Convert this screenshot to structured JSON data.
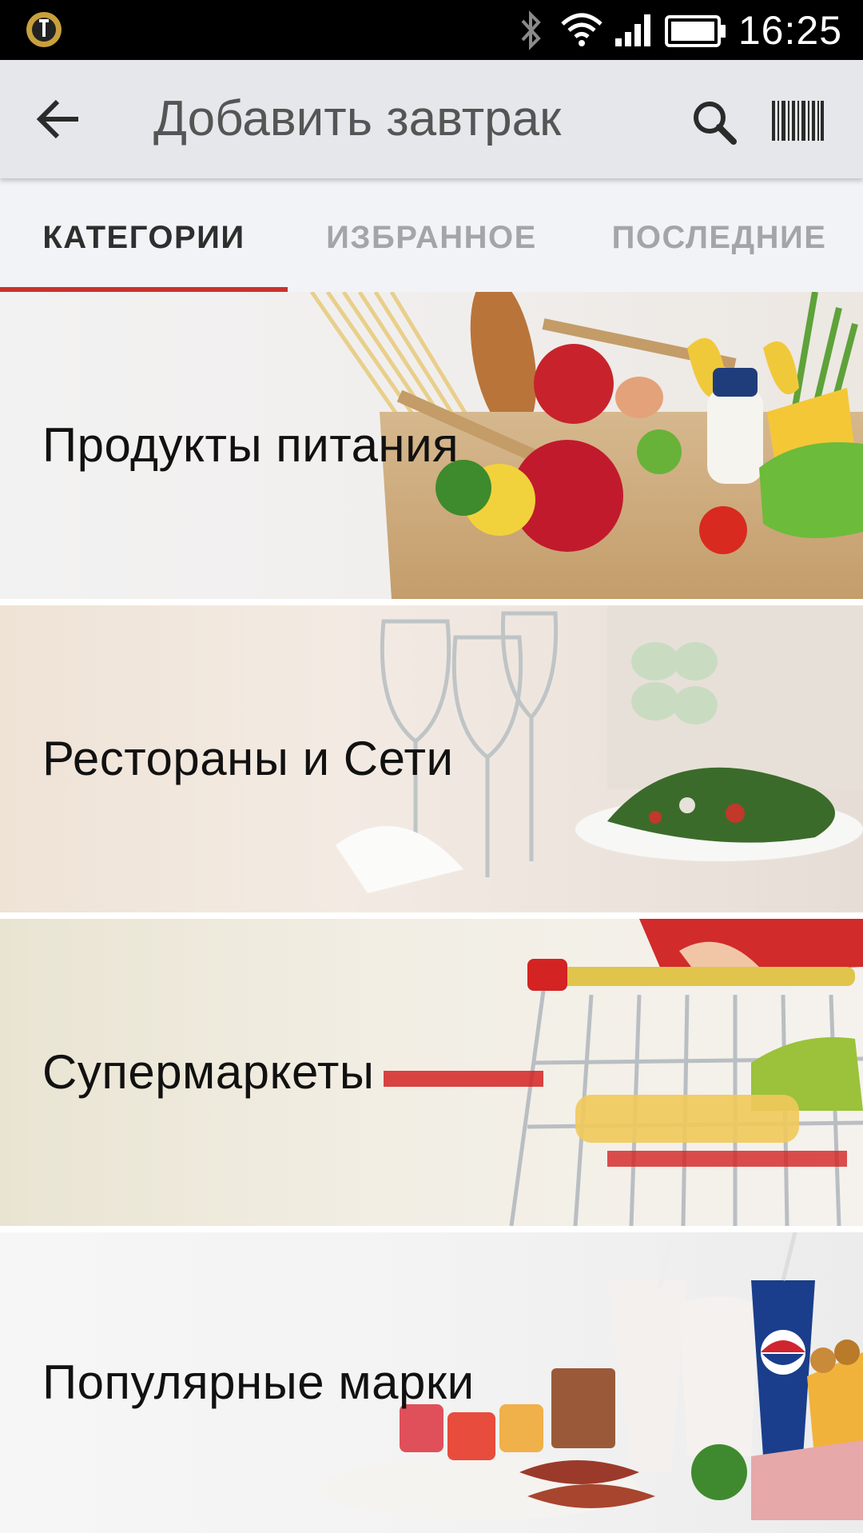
{
  "status_bar": {
    "time": "16:25",
    "icons": [
      "app-logo-icon",
      "bluetooth-icon",
      "wifi-icon",
      "signal-icon",
      "battery-icon"
    ]
  },
  "app_bar": {
    "title": "Добавить завтрак",
    "icons": [
      "back-arrow-icon",
      "search-icon",
      "barcode-icon"
    ]
  },
  "tabs": [
    {
      "label": "КАТЕГОРИИ",
      "active": true
    },
    {
      "label": "ИЗБРАННОЕ",
      "active": false
    },
    {
      "label": "ПОСЛЕДНИЕ",
      "active": false
    }
  ],
  "categories": [
    {
      "label": "Продукты питания",
      "image": "grocery-bag"
    },
    {
      "label": "Рестораны и Сети",
      "image": "restaurant-table"
    },
    {
      "label": "Супермаркеты",
      "image": "shopping-cart"
    },
    {
      "label": "Популярные марки",
      "image": "fast-food-brands"
    }
  ],
  "colors": {
    "accent": "#c9332d",
    "app_bar_bg": "#e6e7ea",
    "tabs_bg": "#f2f3f6"
  }
}
